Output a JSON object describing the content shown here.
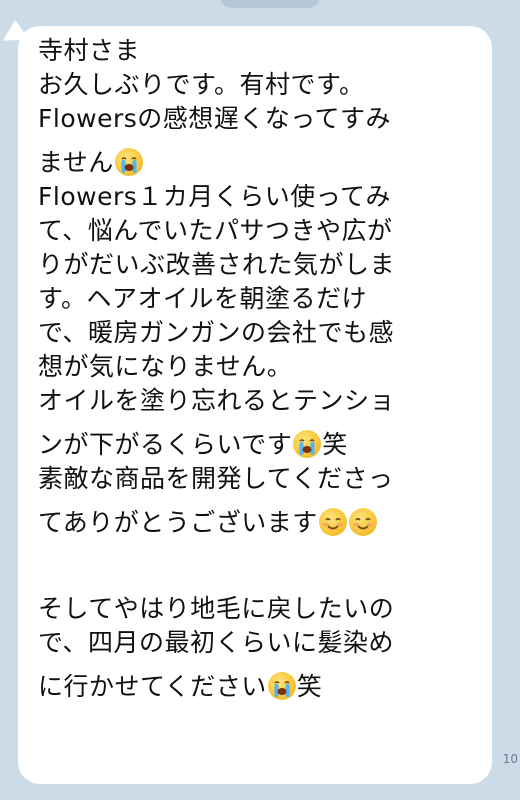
{
  "message": {
    "greeting": "寺村さま",
    "line1": "お久しぶりです。有村です。",
    "line2": "Flowersの感想遅くなってすみ",
    "line3": "ません",
    "line4": "Flowers１カ月くらい使ってみ",
    "line5": "て、悩んでいたパサつきや広が",
    "line6": "りがだいぶ改善された気がしま",
    "line7": "す。ヘアオイルを朝塗るだけ",
    "line8": "で、暖房ガンガンの会社でも感",
    "line9": "想が気になりません。",
    "line10": "オイルを塗り忘れるとテンショ",
    "line11_a": "ンが下がるくらいです",
    "line11_b": "笑",
    "line12": "素敵な商品を開発してくださっ",
    "line13": "てありがとうございます",
    "line14": "そしてやはり地毛に戻したいの",
    "line15": "で、四月の最初くらいに髪染め",
    "line16_a": "に行かせてください",
    "line16_b": "笑"
  },
  "emojis": {
    "crying": "loudly-crying-face-icon",
    "smiling": "smiling-face-icon"
  },
  "timestamp": "10"
}
